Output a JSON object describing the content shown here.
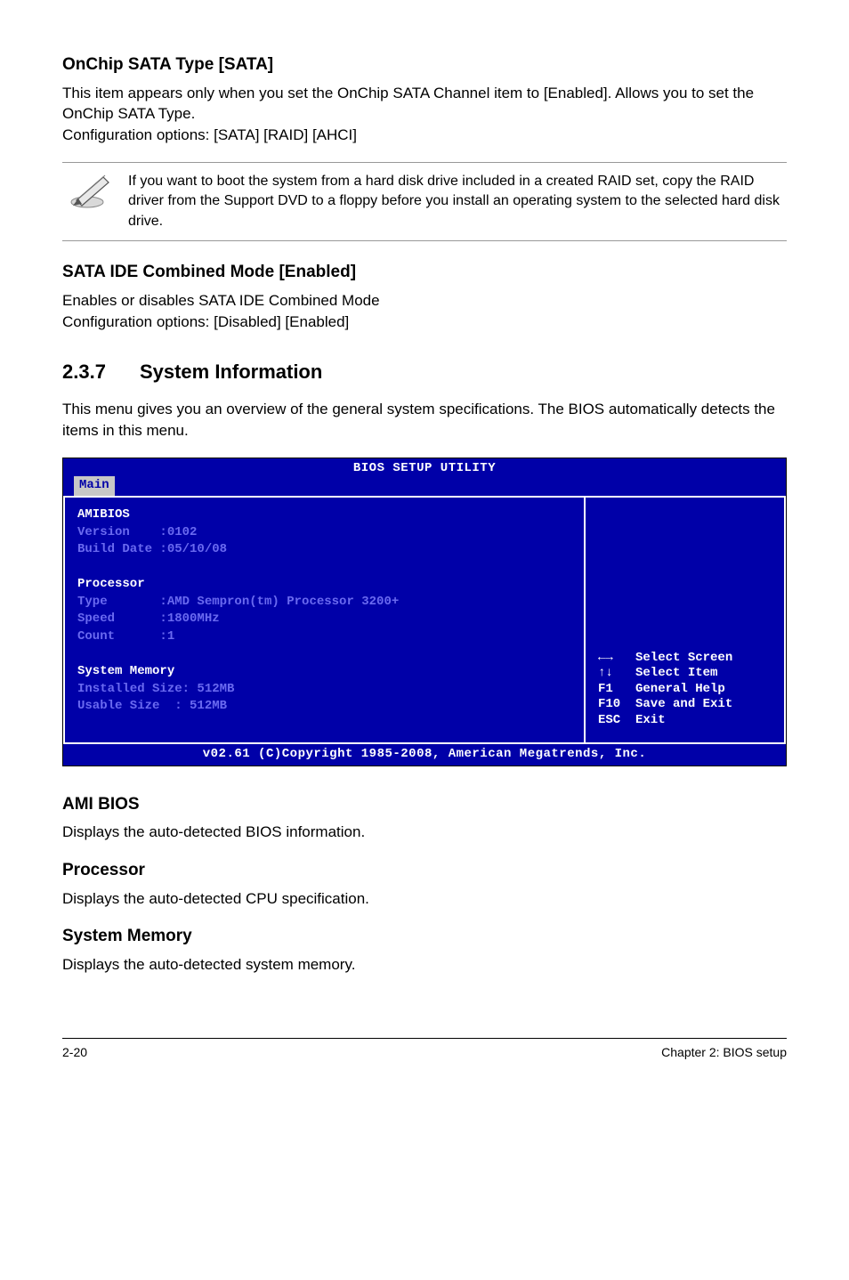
{
  "section1": {
    "heading": "OnChip SATA Type [SATA]",
    "para": "This item appears only when you set the OnChip SATA Channel item to [Enabled]. Allows you to set the OnChip SATA Type.\nConfiguration options: [SATA] [RAID] [AHCI]"
  },
  "note": {
    "text": "If you want to boot the system from a hard disk drive included in a created RAID set, copy the RAID driver from the Support DVD to a floppy before you install an operating system to the selected hard disk drive."
  },
  "section2": {
    "heading": "SATA IDE Combined Mode [Enabled]",
    "para": "Enables or disables SATA IDE Combined Mode\nConfiguration options: [Disabled] [Enabled]"
  },
  "sysinfo": {
    "num": "2.3.7",
    "title": "System Information",
    "intro": "This menu gives you an overview of the general system specifications. The BIOS automatically detects the items in this menu."
  },
  "bios": {
    "title": "BIOS SETUP UTILITY",
    "tab": "Main",
    "left_lines": [
      {
        "text": "AMIBIOS",
        "hl": true
      },
      {
        "text": "Version    :0102",
        "hl": false
      },
      {
        "text": "Build Date :05/10/08",
        "hl": false
      },
      {
        "text": "",
        "hl": false
      },
      {
        "text": "Processor",
        "hl": true
      },
      {
        "text": "Type       :AMD Sempron(tm) Processor 3200+",
        "hl": false
      },
      {
        "text": "Speed      :1800MHz",
        "hl": false
      },
      {
        "text": "Count      :1",
        "hl": false
      },
      {
        "text": "",
        "hl": false
      },
      {
        "text": "System Memory",
        "hl": true
      },
      {
        "text": "Installed Size: 512MB",
        "hl": false
      },
      {
        "text": "Usable Size  : 512MB",
        "hl": false
      }
    ],
    "help": "←→   Select Screen\n↑↓   Select Item\nF1   General Help\nF10  Save and Exit\nESC  Exit",
    "footer": "v02.61 (C)Copyright 1985-2008, American Megatrends, Inc."
  },
  "defs": {
    "ami_h": "AMI BIOS",
    "ami_p": "Displays the auto-detected BIOS information.",
    "proc_h": "Processor",
    "proc_p": "Displays the auto-detected CPU specification.",
    "mem_h": "System Memory",
    "mem_p": "Displays the auto-detected system memory."
  },
  "footer": {
    "left": "2-20",
    "right": "Chapter 2: BIOS setup"
  }
}
